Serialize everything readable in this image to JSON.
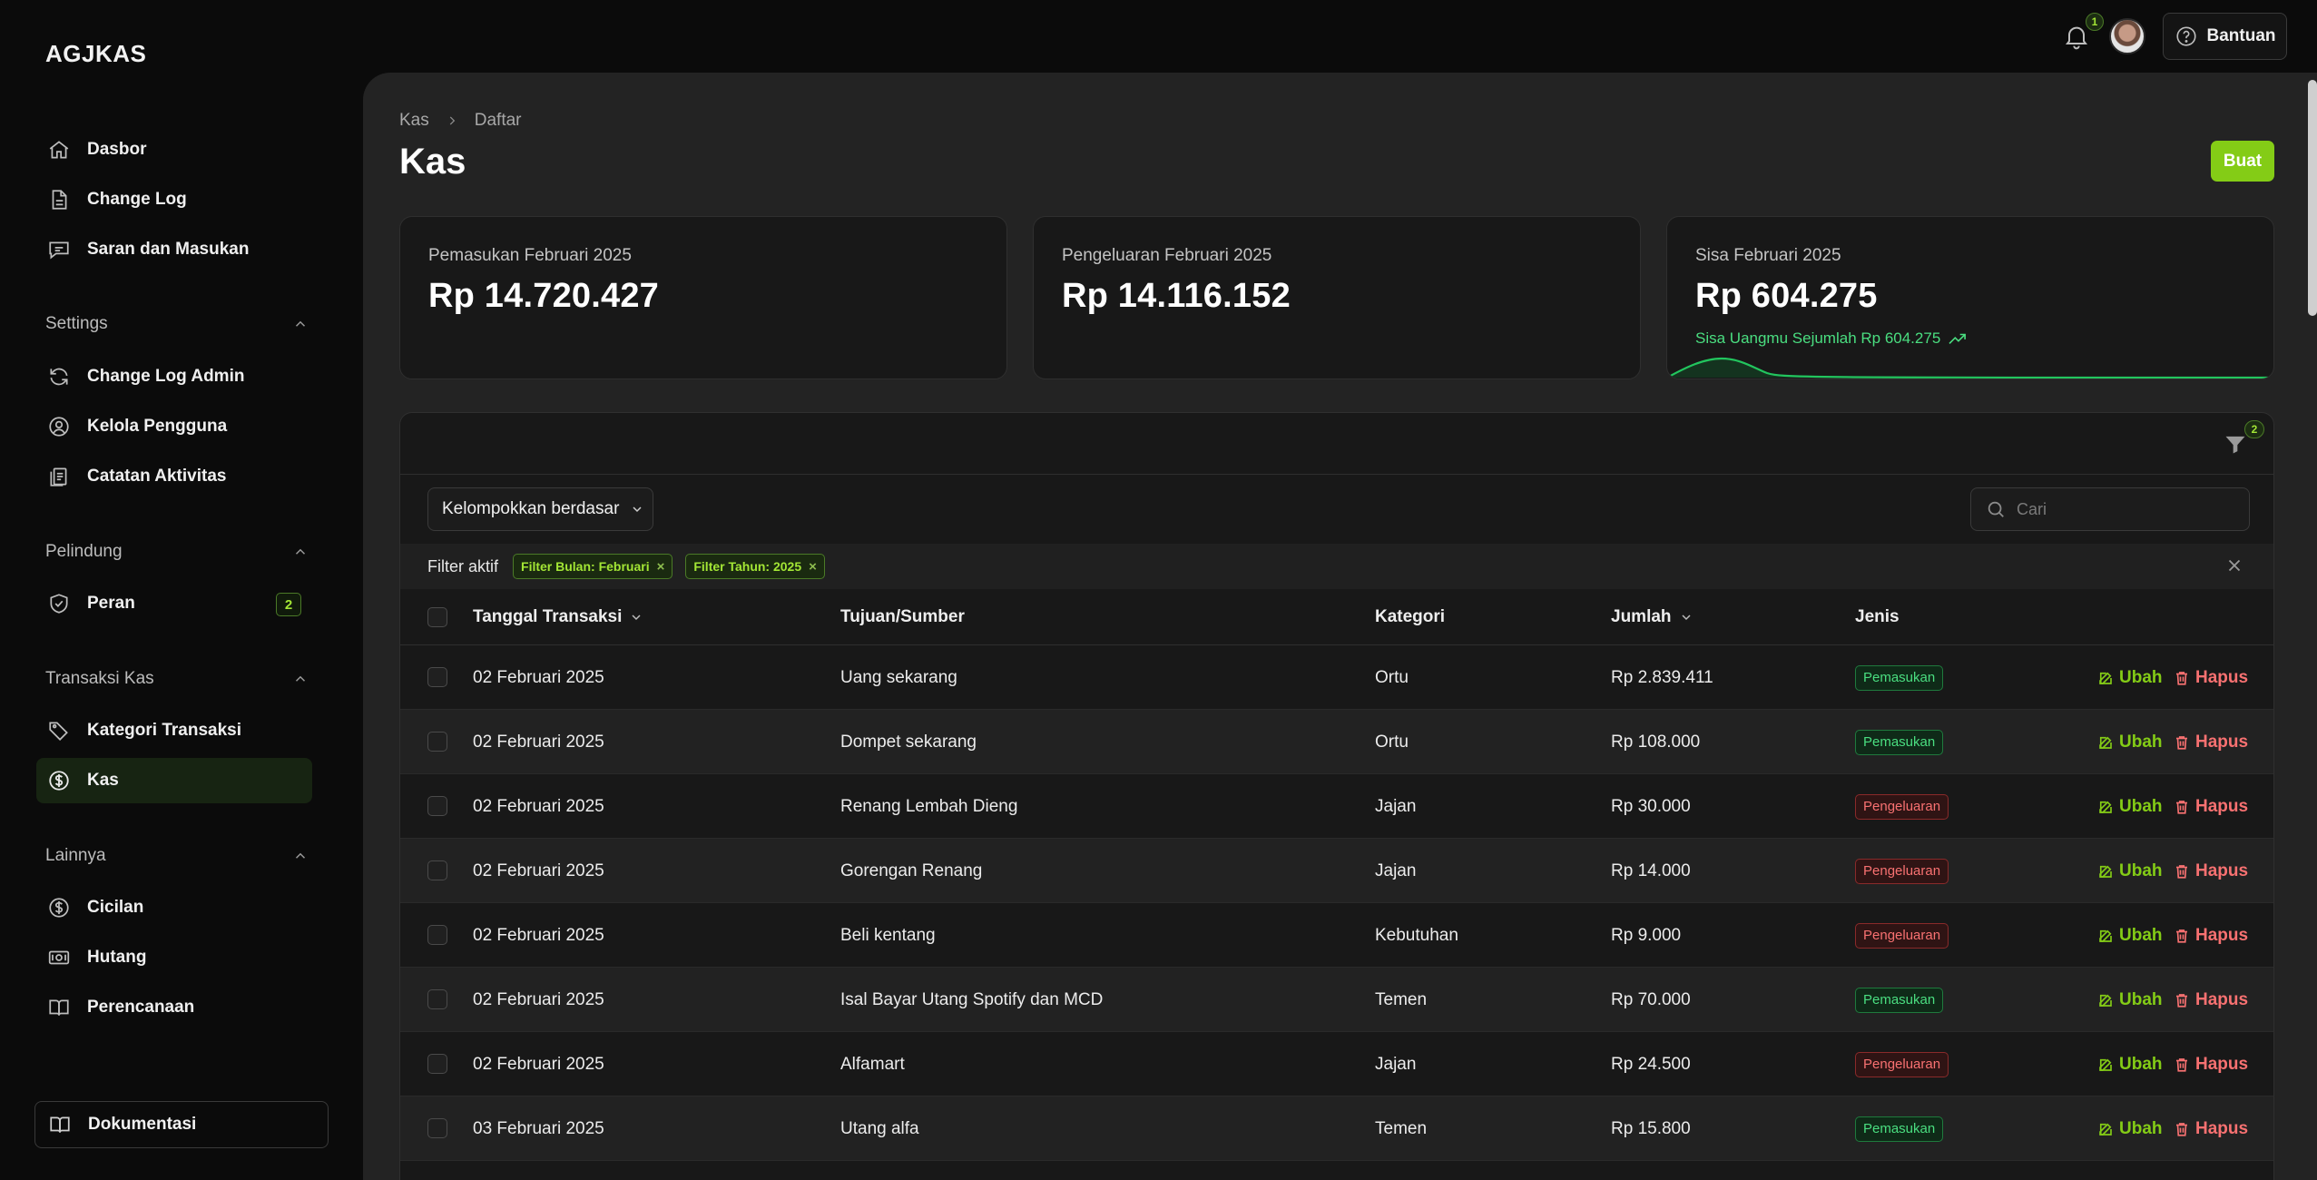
{
  "brand": "AGJKAS",
  "sidebar": {
    "top_items": [
      {
        "label": "Dasbor",
        "icon": "home-icon"
      },
      {
        "label": "Change Log",
        "icon": "document-icon"
      },
      {
        "label": "Saran dan Masukan",
        "icon": "chat-icon"
      }
    ],
    "groups": [
      {
        "label": "Settings",
        "items": [
          {
            "label": "Change Log Admin",
            "icon": "refresh-icon"
          },
          {
            "label": "Kelola Pengguna",
            "icon": "user-circle-icon"
          },
          {
            "label": "Catatan Aktivitas",
            "icon": "clipboard-icon"
          }
        ]
      },
      {
        "label": "Pelindung",
        "items": [
          {
            "label": "Peran",
            "icon": "shield-check-icon",
            "badge": "2"
          }
        ]
      },
      {
        "label": "Transaksi Kas",
        "items": [
          {
            "label": "Kategori Transaksi",
            "icon": "tag-icon"
          },
          {
            "label": "Kas",
            "icon": "dollar-circle-icon",
            "active": true
          }
        ]
      },
      {
        "label": "Lainnya",
        "items": [
          {
            "label": "Cicilan",
            "icon": "dollar-circle-icon"
          },
          {
            "label": "Hutang",
            "icon": "banknote-icon"
          },
          {
            "label": "Perencanaan",
            "icon": "book-open-icon"
          }
        ]
      }
    ],
    "docs_label": "Dokumentasi"
  },
  "topbar": {
    "notification_count": "1",
    "help_label": "Bantuan"
  },
  "page": {
    "breadcrumb": [
      "Kas",
      "Daftar"
    ],
    "title": "Kas",
    "create_label": "Buat"
  },
  "stats": [
    {
      "label": "Pemasukan Februari 2025",
      "value": "Rp 14.720.427"
    },
    {
      "label": "Pengeluaran Februari 2025",
      "value": "Rp 14.116.152"
    },
    {
      "label": "Sisa Februari 2025",
      "value": "Rp 604.275",
      "description": "Sisa Uangmu Sejumlah Rp 604.275"
    }
  ],
  "table": {
    "filter_count": "2",
    "group_by_label": "Kelompokkan berdasar",
    "search_placeholder": "Cari",
    "active_filters_label": "Filter aktif",
    "active_filters": [
      "Filter Bulan: Februari",
      "Filter Tahun: 2025"
    ],
    "columns": [
      "Tanggal Transaksi",
      "Tujuan/Sumber",
      "Kategori",
      "Jumlah",
      "Jenis"
    ],
    "edit_label": "Ubah",
    "delete_label": "Hapus",
    "rows": [
      {
        "date": "02 Februari 2025",
        "purpose": "Uang sekarang",
        "category": "Ortu",
        "amount": "Rp 2.839.411",
        "type": "Pemasukan"
      },
      {
        "date": "02 Februari 2025",
        "purpose": "Dompet sekarang",
        "category": "Ortu",
        "amount": "Rp 108.000",
        "type": "Pemasukan"
      },
      {
        "date": "02 Februari 2025",
        "purpose": "Renang Lembah Dieng",
        "category": "Jajan",
        "amount": "Rp 30.000",
        "type": "Pengeluaran"
      },
      {
        "date": "02 Februari 2025",
        "purpose": "Gorengan Renang",
        "category": "Jajan",
        "amount": "Rp 14.000",
        "type": "Pengeluaran"
      },
      {
        "date": "02 Februari 2025",
        "purpose": "Beli kentang",
        "category": "Kebutuhan",
        "amount": "Rp 9.000",
        "type": "Pengeluaran"
      },
      {
        "date": "02 Februari 2025",
        "purpose": "Isal Bayar Utang Spotify dan MCD",
        "category": "Temen",
        "amount": "Rp 70.000",
        "type": "Pemasukan"
      },
      {
        "date": "02 Februari 2025",
        "purpose": "Alfamart",
        "category": "Jajan",
        "amount": "Rp 24.500",
        "type": "Pengeluaran"
      },
      {
        "date": "03 Februari 2025",
        "purpose": "Utang alfa",
        "category": "Temen",
        "amount": "Rp 15.800",
        "type": "Pemasukan"
      }
    ]
  },
  "colors": {
    "accent": "#84cc16",
    "income": "#4ade80",
    "expense": "#f87171",
    "background": "#0b0b0b",
    "panel": "#232323"
  }
}
